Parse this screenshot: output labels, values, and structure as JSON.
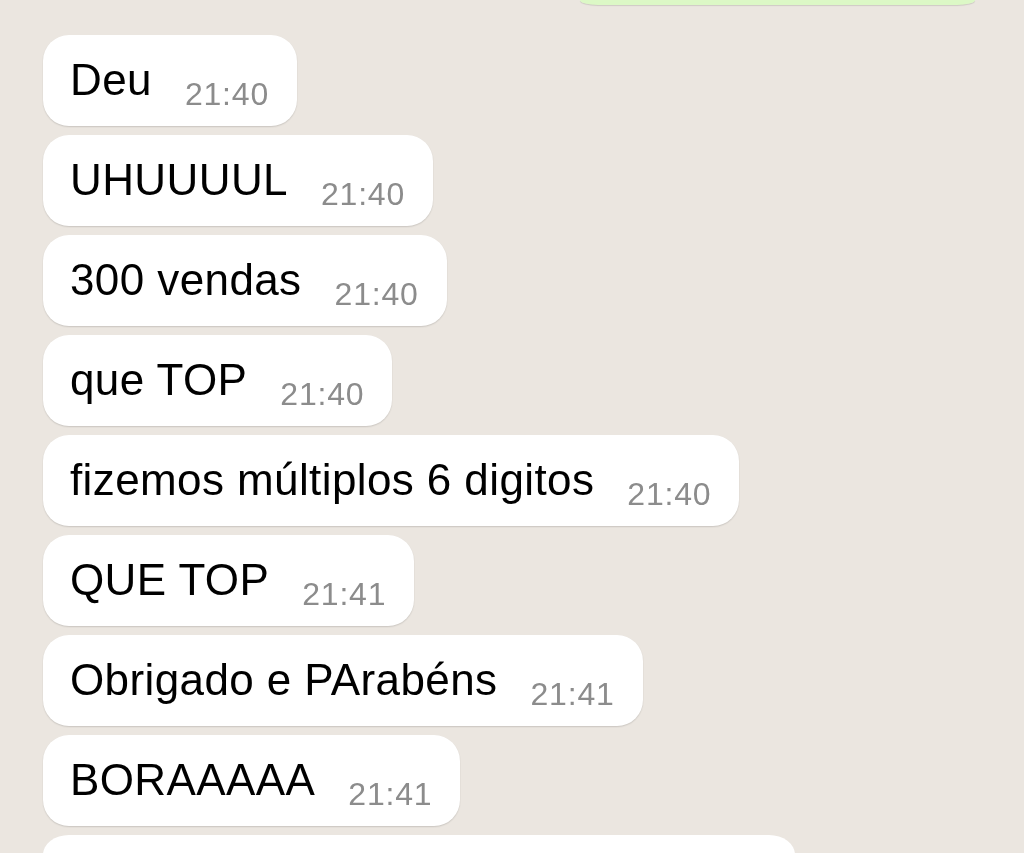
{
  "chat": {
    "messages": [
      {
        "kind": "sent_clipped"
      },
      {
        "kind": "received",
        "text": "Deu",
        "time": "21:40"
      },
      {
        "kind": "received",
        "text": "UHUUUUL",
        "time": "21:40"
      },
      {
        "kind": "received",
        "text": "300 vendas",
        "time": "21:40"
      },
      {
        "kind": "received",
        "text": "que TOP",
        "time": "21:40"
      },
      {
        "kind": "received",
        "text": "fizemos múltiplos 6 digitos",
        "time": "21:40"
      },
      {
        "kind": "received",
        "text": "QUE TOP",
        "time": "21:41"
      },
      {
        "kind": "received",
        "text": "Obrigado e PArabéns",
        "time": "21:41"
      },
      {
        "kind": "received",
        "text": "BORAAAAA",
        "time": "21:41"
      },
      {
        "kind": "received_clipped"
      }
    ]
  }
}
